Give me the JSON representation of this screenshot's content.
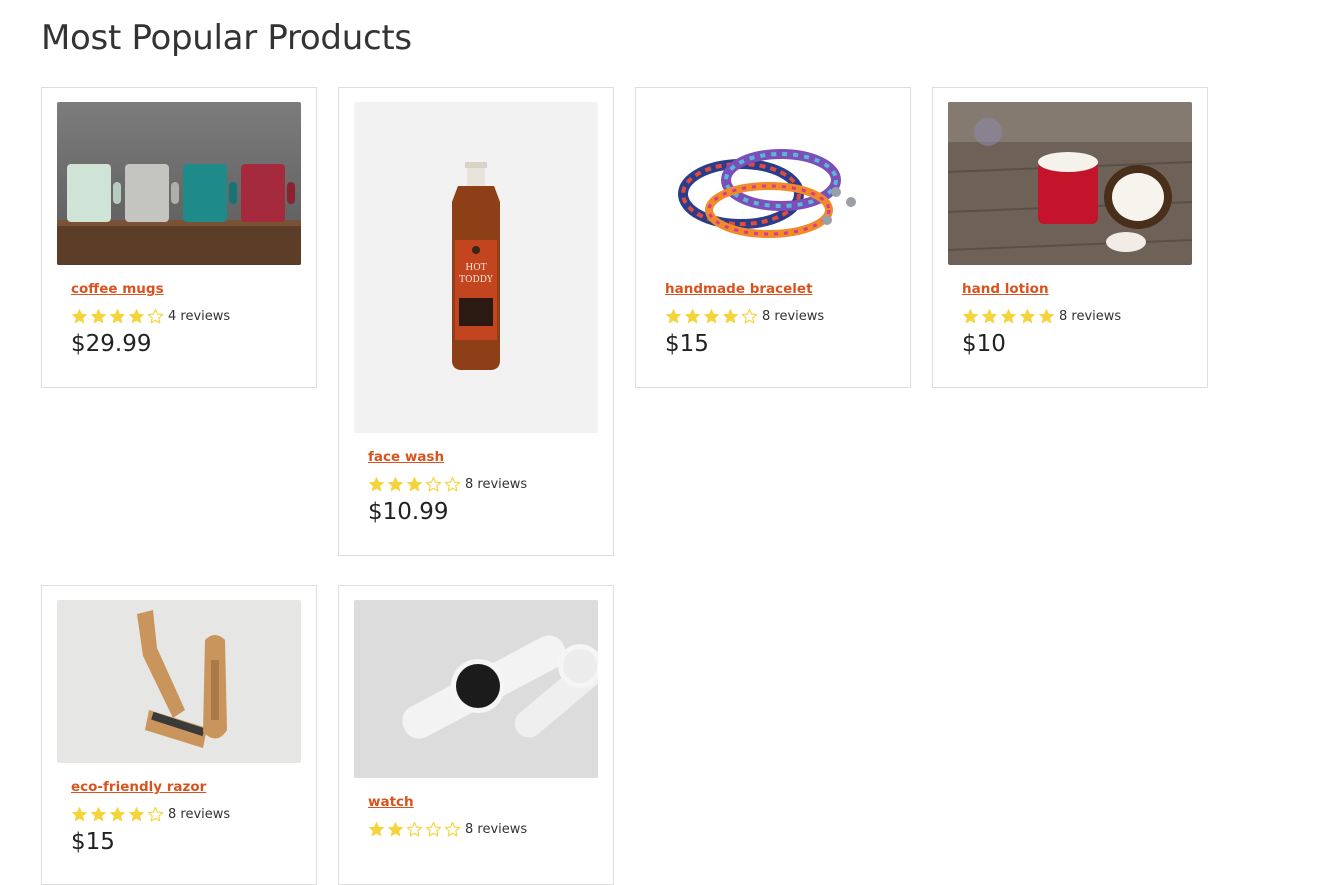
{
  "page": {
    "title": "Most Popular Products"
  },
  "colors": {
    "accent": "#d9531e",
    "star": "#f4d43a",
    "border": "#dedede"
  },
  "products": [
    {
      "name": "coffee mugs",
      "rating": 4,
      "max_rating": 5,
      "reviews": "4 reviews",
      "price": "$29.99",
      "image": "coffee-mugs-image"
    },
    {
      "name": "face wash",
      "rating": 3,
      "max_rating": 5,
      "reviews": "8 reviews",
      "price": "$10.99",
      "image": "hot-toddy-bottle-image"
    },
    {
      "name": "handmade bracelet",
      "rating": 4,
      "max_rating": 5,
      "reviews": "8 reviews",
      "price": "$15",
      "image": "bracelets-image"
    },
    {
      "name": "hand lotion",
      "rating": 5,
      "max_rating": 5,
      "reviews": "8 reviews",
      "price": "$10",
      "image": "lotion-coconut-image"
    },
    {
      "name": "eco-friendly razor",
      "rating": 4,
      "max_rating": 5,
      "reviews": "8 reviews",
      "price": "$15",
      "image": "razor-image"
    },
    {
      "name": "watch",
      "rating": 2,
      "max_rating": 5,
      "reviews": "8 reviews",
      "price": "",
      "image": "watch-image"
    }
  ]
}
